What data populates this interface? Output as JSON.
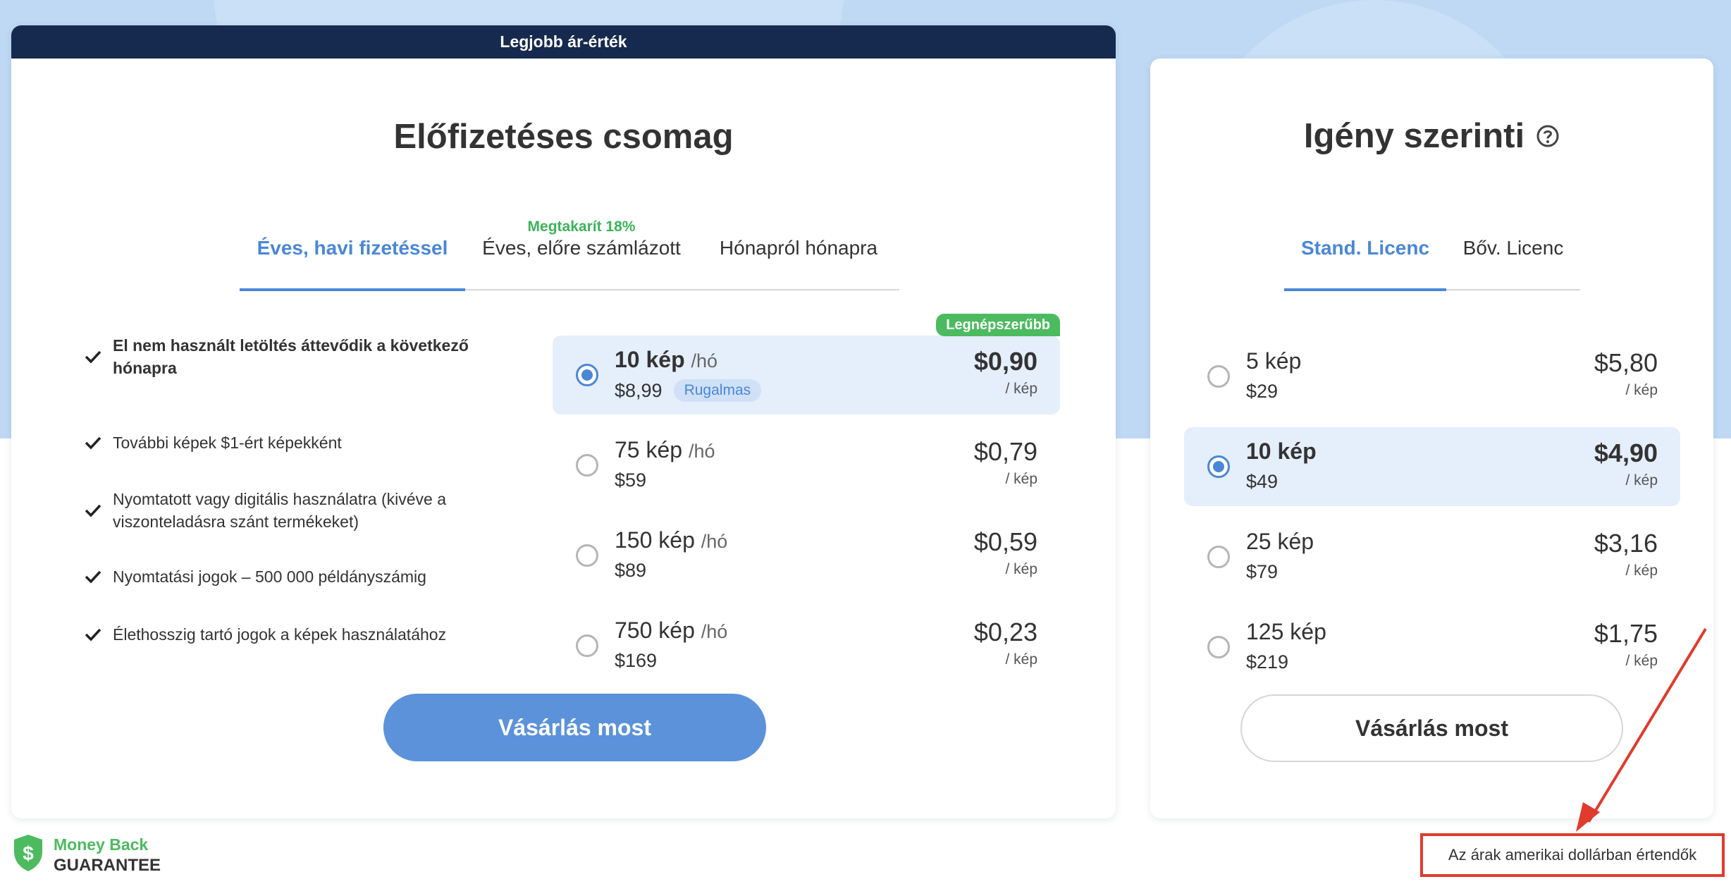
{
  "subscription": {
    "banner": "Legjobb ár-érték",
    "title": "Előfizetéses csomag",
    "tabs": [
      {
        "label": "Éves, havi fizetéssel",
        "active": true
      },
      {
        "label": "Éves, előre számlázott",
        "save_label": "Megtakarít 18%"
      },
      {
        "label": "Hónapról hónapra"
      }
    ],
    "features": [
      "El nem használt letöltés áttevődik a következő hónapra",
      "További képek $1-ért képekként",
      "Nyomtatott vagy digitális használatra (kivéve a viszonteladásra szánt termékeket)",
      "Nyomtatási jogok – 500 000 példányszámig",
      "Élethosszig tartó jogok a képek használatához"
    ],
    "popular_badge": "Legnépszerűbb",
    "plans": [
      {
        "qty": "10 kép",
        "period": "/hó",
        "price": "$8,99",
        "badge": "Rugalmas",
        "unit_price": "$0,90",
        "unit_label": "/ kép",
        "selected": true
      },
      {
        "qty": "75 kép",
        "period": "/hó",
        "price": "$59",
        "unit_price": "$0,79",
        "unit_label": "/ kép"
      },
      {
        "qty": "150 kép",
        "period": "/hó",
        "price": "$89",
        "unit_price": "$0,59",
        "unit_label": "/ kép"
      },
      {
        "qty": "750 kép",
        "period": "/hó",
        "price": "$169",
        "unit_price": "$0,23",
        "unit_label": "/ kép"
      }
    ],
    "buy_label": "Vásárlás most"
  },
  "on_demand": {
    "title": "Igény szerinti",
    "tabs": [
      {
        "label": "Stand. Licenc",
        "active": true
      },
      {
        "label": "Bőv. Licenc"
      }
    ],
    "plans": [
      {
        "qty": "5 kép",
        "price": "$29",
        "unit_price": "$5,80",
        "unit_label": "/ kép"
      },
      {
        "qty": "10 kép",
        "price": "$49",
        "unit_price": "$4,90",
        "unit_label": "/ kép",
        "selected": true
      },
      {
        "qty": "25 kép",
        "price": "$79",
        "unit_price": "$3,16",
        "unit_label": "/ kép"
      },
      {
        "qty": "125 kép",
        "price": "$219",
        "unit_price": "$1,75",
        "unit_label": "/ kép"
      }
    ],
    "buy_label": "Vásárlás most"
  },
  "footer": {
    "money_back_line1": "Money Back",
    "money_back_line2": "GUARANTEE",
    "currency_note": "Az árak amerikai dollárban értendők"
  },
  "colors": {
    "accent": "#4a87d6",
    "banner": "#16294e",
    "green": "#4cbb5f",
    "highlight": "#e03b2c",
    "background": "#bfd9f4"
  }
}
